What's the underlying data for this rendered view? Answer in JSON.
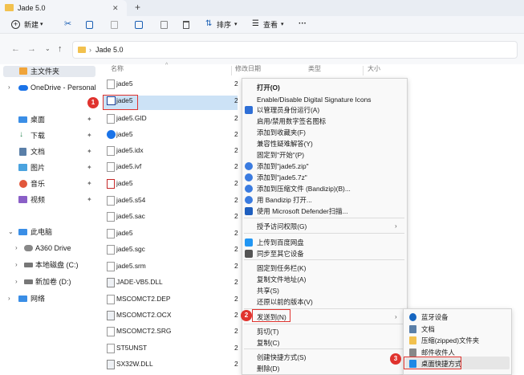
{
  "window": {
    "tab_title": "Jade 5.0",
    "add_tab": "+"
  },
  "toolbar": {
    "new": "新建",
    "sort": "排序",
    "view": "查看",
    "more": "···"
  },
  "address": {
    "path": "Jade 5.0",
    "sep": "›"
  },
  "sidebar": {
    "home": "主文件夹",
    "onedrive": "OneDrive - Personal",
    "quick": [
      "桌面",
      "下载",
      "文档",
      "图片",
      "音乐",
      "视频"
    ],
    "thispc": "此电脑",
    "drives": [
      "A360 Drive",
      "本地磁盘 (C:)",
      "新加卷 (D:)"
    ],
    "network": "网络"
  },
  "columns": {
    "name": "名称",
    "date": "修改日期",
    "type": "类型",
    "size": "大小"
  },
  "files": [
    "jade5",
    "jade5",
    "jade5.GID",
    "jade5",
    "jade5.idx",
    "jade5.ivf",
    "jade5",
    "jade5.s54",
    "jade5.sac",
    "jade5",
    "jade5.sgc",
    "jade5.srm",
    "JADE-VB5.DLL",
    "MSCOMCT2.DEP",
    "MSCOMCT2.OCX",
    "MSCOMCT2.SRG",
    "ST5UNST",
    "SX32W.DLL"
  ],
  "date_prefix": "2",
  "context_menu": [
    "打开(O)",
    "Enable/Disable Digital Signature Icons",
    "以管理员身份运行(A)",
    "启用/禁用数字签名图标",
    "添加到收藏夹(F)",
    "兼容性疑难解答(Y)",
    "固定到\"开始\"(P)",
    "添加到\"jade5.zip\"",
    "添加到\"jade5.7z\"",
    "添加到压缩文件 (Bandizip)(B)...",
    "用 Bandizip 打开...",
    "使用 Microsoft Defender扫描...",
    "授予访问权限(G)",
    "上传到百度网盘",
    "同步至其它设备",
    "固定到任务栏(K)",
    "复制文件地址(A)",
    "共享(S)",
    "还原以前的版本(V)",
    "发送到(N)",
    "剪切(T)",
    "复制(C)",
    "创建快捷方式(S)",
    "删除(D)"
  ],
  "submenu": [
    "蓝牙设备",
    "文档",
    "压缩(zipped)文件夹",
    "邮件收件人",
    "桌面快捷方式"
  ],
  "badges": [
    "1",
    "2",
    "3"
  ],
  "colors": {
    "accent": "#0067c0",
    "badge": "#e0332e",
    "selection": "#cce2f6"
  }
}
